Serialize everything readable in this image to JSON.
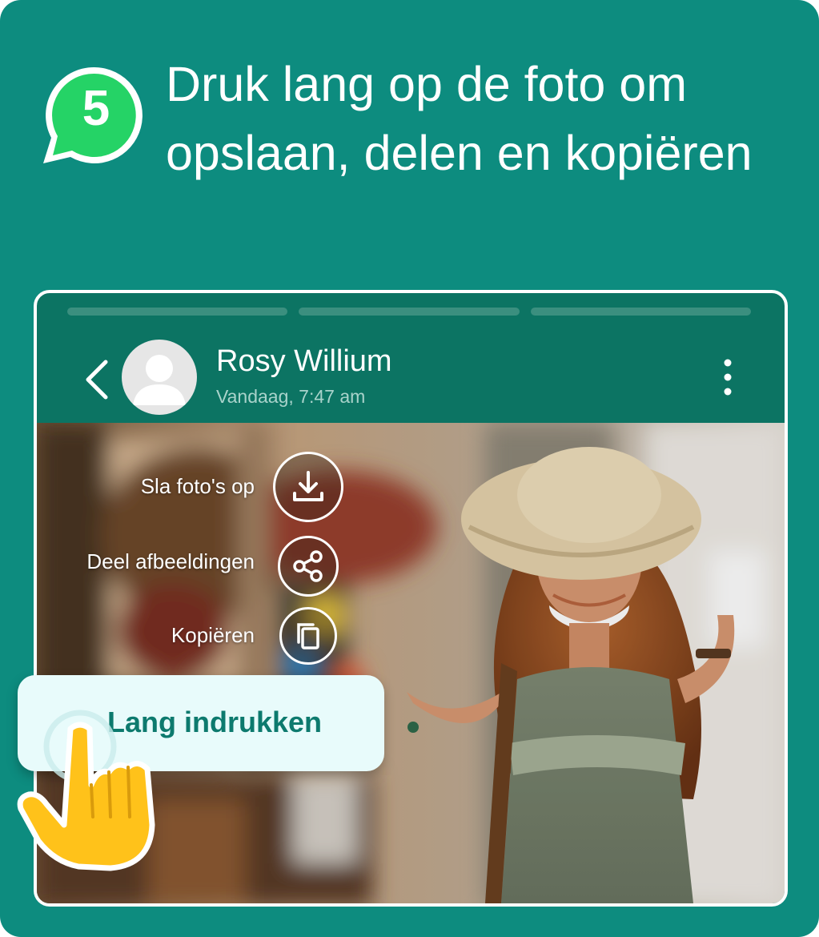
{
  "step": {
    "number": "5"
  },
  "title": {
    "line1": "Druk lang op de foto om",
    "line2": "opslaan, delen en kopiëren"
  },
  "chat": {
    "contact_name": "Rosy Willium",
    "timestamp": "Vandaag, 7:47 am"
  },
  "menu": {
    "save_label": "Sla foto's op",
    "share_label": "Deel afbeeldingen",
    "copy_label": "Kopiëren"
  },
  "hint": {
    "label": "Lang indrukken"
  },
  "colors": {
    "background": "#0d8c7f",
    "header": "#0c7463",
    "accent": "#25d366",
    "hint_text": "#0d7a6e",
    "hand": "#ffc21a"
  },
  "icons": [
    "whatsapp-bubble-icon",
    "back-arrow-icon",
    "avatar-icon",
    "more-vert-icon",
    "download-icon",
    "share-icon",
    "copy-icon",
    "pointing-hand-icon"
  ]
}
